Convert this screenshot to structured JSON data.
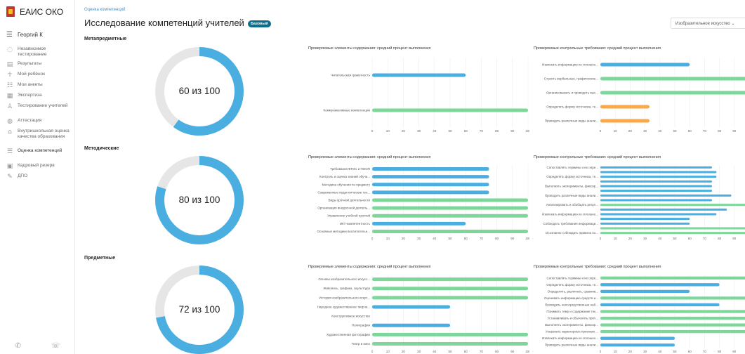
{
  "sidebar": {
    "logo_text": "ЕАИС ОКО",
    "user_name": "Георгий К",
    "items": [
      {
        "label": "Независимое тестирование",
        "icon": "shield-icon"
      },
      {
        "label": "Результаты",
        "icon": "results-icon"
      },
      {
        "label": "Мой ребёнок",
        "icon": "child-icon"
      },
      {
        "label": "Мои анкеты",
        "icon": "survey-icon"
      },
      {
        "label": "Экспертиза",
        "icon": "expertise-icon"
      },
      {
        "label": "Тестирование учителей",
        "icon": "teacher-icon"
      },
      {
        "label": "Аттестация",
        "icon": "attestation-icon"
      },
      {
        "label": "Внутришкольная оценка качества образования",
        "icon": "school-icon"
      },
      {
        "label": "Оценка компетенций",
        "icon": "list-icon"
      },
      {
        "label": "Кадровый резерв",
        "icon": "reserve-icon"
      },
      {
        "label": "ДПО",
        "icon": "pen-icon"
      }
    ]
  },
  "header": {
    "breadcrumb": "Оценка компетенций",
    "title": "Исследование компетенций учителей",
    "badge": "Базовый",
    "subject_select": "Изобразительное искусство"
  },
  "colors": {
    "blue": "#4aaee0",
    "green": "#7dd69a",
    "orange": "#f7a94b",
    "grey": "#e6e6e6"
  },
  "sections": [
    {
      "title": "Метапредметные",
      "score_text": "60 из 100",
      "score": 60,
      "max": 100
    },
    {
      "title": "Методические",
      "score_text": "80 из 100",
      "score": 80,
      "max": 100
    },
    {
      "title": "Предметные",
      "score_text": "72 из 100",
      "score": 72,
      "max": 100
    }
  ],
  "chart_data": [
    {
      "type": "bar",
      "title": "Проверяемые элементы содержания: средний процент выполнения",
      "categories": [
        "Читательская грамотность",
        "Коммуникативные компетенции"
      ],
      "values": [
        60,
        100
      ],
      "colors": [
        "blue",
        "green"
      ],
      "xlim": [
        0,
        100
      ],
      "ticks": [
        0,
        10,
        20,
        30,
        40,
        50,
        60,
        70,
        80,
        90,
        100
      ]
    },
    {
      "type": "bar",
      "title": "Проверяемые контрольные требования: средний процент выполнения",
      "categories": [
        "Извлекать информацию из сплошно...",
        "Строить вербальные, графические...",
        "Организовывать и проводить выс...",
        "Определять форму источника, те...",
        "Проводить различные виды анали..."
      ],
      "values": [
        60,
        100,
        100,
        33,
        33
      ],
      "colors": [
        "blue",
        "green",
        "green",
        "orange",
        "orange"
      ],
      "xlim": [
        0,
        100
      ],
      "ticks": [
        0,
        10,
        20,
        30,
        40,
        50,
        60,
        70,
        80,
        90,
        100
      ]
    },
    {
      "type": "bar",
      "title": "Проверяемые элементы содержания: средний процент выполнения",
      "categories": [
        "Требования ФГОС и ПООП",
        "Контроль и оценка знаний обуча...",
        "Методика обучения по предмету",
        "Современные педагогические тех...",
        "Виды урочной деятельности",
        "Организация внеурочной деятель...",
        "Управление учебной группой",
        "ИКТ-компетентность",
        "Основные методики воспитательн..."
      ],
      "values": [
        75,
        75,
        75,
        75,
        100,
        100,
        100,
        60,
        100
      ],
      "colors": [
        "blue",
        "blue",
        "blue",
        "blue",
        "green",
        "green",
        "green",
        "blue",
        "green"
      ],
      "xlim": [
        0,
        100
      ],
      "ticks": [
        0,
        10,
        20,
        30,
        40,
        50,
        60,
        70,
        80,
        90,
        100
      ]
    },
    {
      "type": "bar",
      "title": "Проверяемые контрольные требования: средний процент выполнения",
      "categories": [
        "Сопоставлять термины и их опре...",
        "",
        "Определять форму источника, те...",
        "",
        "Выполнять эксперименты, фиксир...",
        "",
        "Проводить различные виды анали...",
        "",
        "Анализировать и обобщать резул...",
        "",
        "Извлекать информацию из сплошно...",
        "",
        "Соблюдать требования информаци...",
        "",
        "Осознанно соблюдать правила по..."
      ],
      "values": [
        75,
        78,
        78,
        75,
        75,
        75,
        88,
        75,
        100,
        85,
        78,
        60,
        60,
        100,
        100
      ],
      "colors": [
        "blue",
        "blue",
        "blue",
        "blue",
        "blue",
        "blue",
        "blue",
        "blue",
        "green",
        "blue",
        "blue",
        "blue",
        "blue",
        "green",
        "green"
      ],
      "xlim": [
        0,
        100
      ],
      "ticks": [
        0,
        10,
        20,
        30,
        40,
        50,
        60,
        70,
        80,
        90,
        100
      ]
    },
    {
      "type": "bar",
      "title": "Проверяемые элементы содержания: средний процент выполнения",
      "categories": [
        "Основы изобразительного искусс...",
        "Живопись, графика, скульптура",
        "История изобразительного искус...",
        "Народное художественное творче...",
        "Конструктивное искусство",
        "Полиграфия",
        "Художественная фотография",
        "Театр и кино"
      ],
      "values": [
        100,
        100,
        100,
        50,
        0,
        50,
        100,
        100
      ],
      "colors": [
        "green",
        "green",
        "green",
        "blue",
        "blue",
        "blue",
        "green",
        "green"
      ],
      "xlim": [
        0,
        100
      ],
      "ticks": [
        0,
        10,
        20,
        30,
        40,
        50,
        60,
        70,
        80,
        90,
        100
      ]
    },
    {
      "type": "bar",
      "title": "Проверяемые контрольные требования: средний процент выполнения",
      "categories": [
        "Сопоставлять термины и их опре...",
        "Определять форму источника, те...",
        "Определять, различать, сравнив...",
        "Оценивать информацию средств и...",
        "Проводить непосредственные наб...",
        "Понимать тему и содержание тек...",
        "Устанавливать и объяснять прич...",
        "Выполнять эксперименты, фиксир...",
        "Указывать характерные признаки ...",
        "Извлекать информацию из сплошно...",
        "Проводить различные виды анали..."
      ],
      "values": [
        100,
        80,
        60,
        100,
        80,
        100,
        100,
        100,
        100,
        50,
        50
      ],
      "colors": [
        "green",
        "blue",
        "blue",
        "green",
        "blue",
        "green",
        "green",
        "green",
        "green",
        "blue",
        "blue"
      ],
      "xlim": [
        0,
        100
      ],
      "ticks": [
        0,
        10,
        20,
        30,
        40,
        50,
        60,
        70,
        80,
        90,
        100
      ]
    }
  ]
}
